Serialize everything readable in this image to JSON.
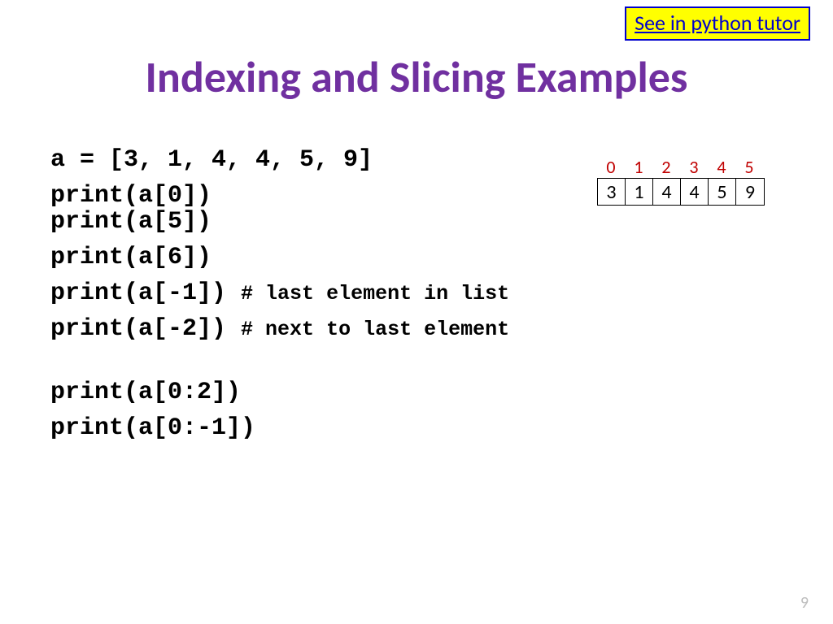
{
  "link": {
    "label": "See in python tutor"
  },
  "title": "Indexing and Slicing Examples",
  "code": {
    "l1": "a = [3, 1, 4, 4, 5, 9]",
    "l2": "print(a[0])",
    "l3": "print(a[5])",
    "l4": "print(a[6])",
    "l5": "print(a[-1]) ",
    "c5": "# last element in list",
    "l6": "print(a[-2]) ",
    "c6": "# next to last element",
    "l7": "print(a[0:2])",
    "l8": "print(a[0:-1])"
  },
  "array": {
    "indices": [
      "0",
      "1",
      "2",
      "3",
      "4",
      "5"
    ],
    "values": [
      "3",
      "1",
      "4",
      "4",
      "5",
      "9"
    ]
  },
  "page": "9"
}
